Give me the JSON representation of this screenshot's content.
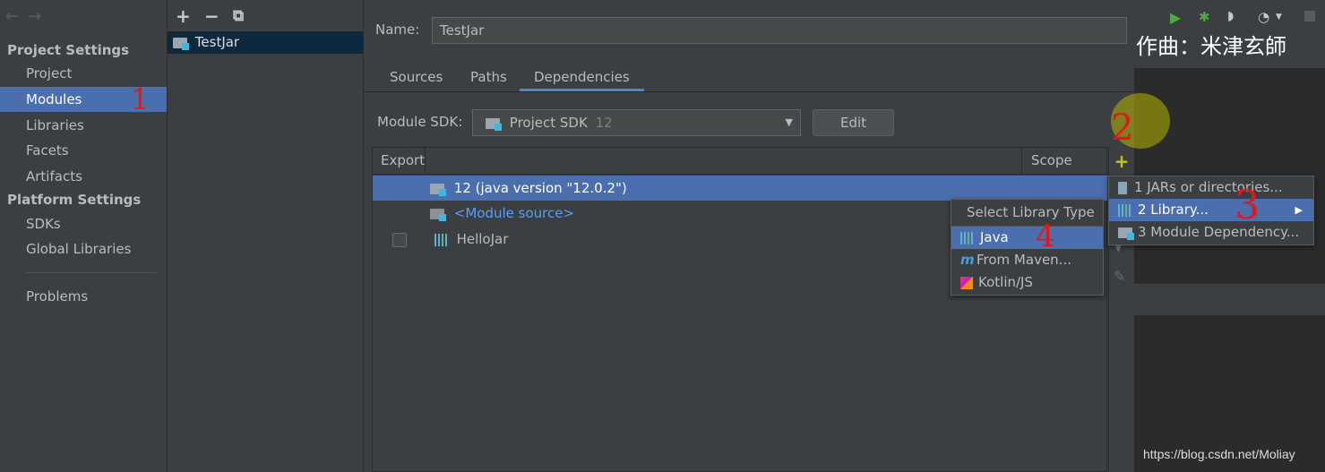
{
  "sidebar": {
    "nav_back": "←",
    "nav_forward": "→",
    "project_settings_title": "Project Settings",
    "project_items": [
      "Project",
      "Modules",
      "Libraries",
      "Facets",
      "Artifacts"
    ],
    "platform_settings_title": "Platform Settings",
    "platform_items": [
      "SDKs",
      "Global Libraries"
    ],
    "problems": "Problems"
  },
  "modules": {
    "add": "+",
    "remove": "−",
    "copy": "⧉",
    "items": [
      "TestJar"
    ]
  },
  "main": {
    "name_label": "Name:",
    "name_value": "TestJar",
    "tabs": [
      "Sources",
      "Paths",
      "Dependencies"
    ],
    "active_tab": "Dependencies",
    "module_sdk_label": "Module SDK:",
    "sdk_value": "Project SDK",
    "sdk_version": "12",
    "edit_button": "Edit",
    "table": {
      "headers": [
        "Export",
        "Scope"
      ],
      "rows": [
        {
          "name": "12 (java version \"12.0.2\")",
          "selected": true
        },
        {
          "name": "<Module source>",
          "selected": false
        },
        {
          "name": "HelloJar",
          "selected": false
        }
      ]
    },
    "toolbar": {
      "add": "+"
    }
  },
  "add_menu": {
    "items": [
      "1  JARs or directories...",
      "2  Library...",
      "3  Module Dependency..."
    ],
    "selected": 1
  },
  "library_type_menu": {
    "title": "Select Library Type",
    "items": [
      "Java",
      "From Maven...",
      "Kotlin/JS"
    ],
    "selected": 0
  },
  "overlay": {
    "caption": "作曲：米津玄師",
    "watermark": "https://blog.csdn.net/Moliay",
    "annotations": [
      "1",
      "2",
      "3",
      "4"
    ]
  },
  "colors": {
    "background": "#3c3f41",
    "selection": "#4b6eaf",
    "link": "#589df6",
    "annotation": "#e01818",
    "highlight": "#b8b800"
  }
}
